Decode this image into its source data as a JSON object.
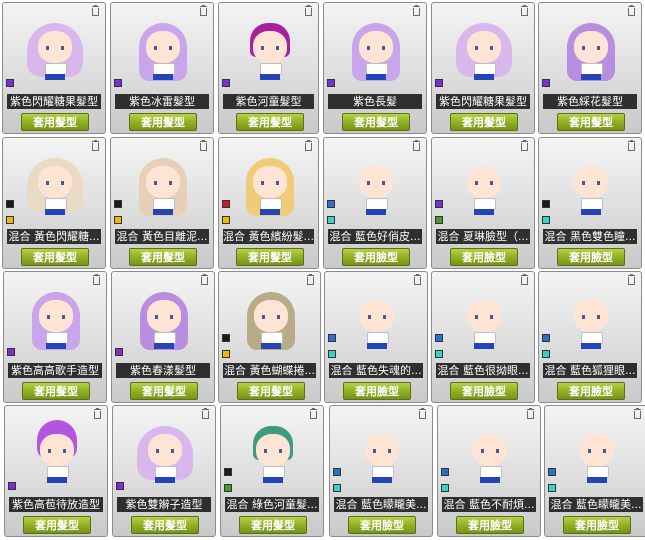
{
  "actions": {
    "apply_hair": "套用髮型",
    "apply_face": "套用臉型"
  },
  "colors": {
    "button_green": "#8fae22",
    "name_bar": "#2f2f2f",
    "purple": "#7a2fd0",
    "black": "#1a1a1a",
    "yellow": "#f2b800",
    "red": "#d01a1a",
    "green": "#4c9a2a",
    "blue": "#2870d0",
    "teal": "#3ccfc8"
  },
  "cards": [
    {
      "name": "紫色閃耀糖果髮型",
      "action": "套用髮型",
      "swatches": [
        "purple"
      ],
      "look": "lavender-twintails"
    },
    {
      "name": "紫色冰雷髮型",
      "action": "套用髮型",
      "swatches": [
        "purple"
      ],
      "look": "lavender-long"
    },
    {
      "name": "紫色河童髮型",
      "action": "套用髮型",
      "swatches": [
        "purple"
      ],
      "look": "magenta-bob"
    },
    {
      "name": "紫色長髮",
      "action": "套用髮型",
      "swatches": [
        "purple"
      ],
      "look": "lavender-long"
    },
    {
      "name": "紫色閃耀糖果髮型",
      "action": "套用髮型",
      "swatches": [
        "purple"
      ],
      "look": "lavender-twintails"
    },
    {
      "name": "紫色綵花髮型",
      "action": "套用髮型",
      "swatches": [
        "purple"
      ],
      "look": "lavender-wavy"
    },
    {
      "name": "混合 黃色閃耀糖...",
      "action": "套用髮型",
      "swatches": [
        "black",
        "yellow"
      ],
      "look": "cream-twintails"
    },
    {
      "name": "混合 黃色目離泥...",
      "action": "套用髮型",
      "swatches": [
        "black",
        "yellow"
      ],
      "look": "cream-long"
    },
    {
      "name": "混合 黃色繽紛髮...",
      "action": "套用髮型",
      "swatches": [
        "red",
        "yellow"
      ],
      "look": "blonde-wavy"
    },
    {
      "name": "混合 藍色好俏皮...",
      "action": "套用臉型",
      "swatches": [
        "blue",
        "teal"
      ],
      "look": "bald"
    },
    {
      "name": "混合 夏琳臉型（...",
      "action": "套用臉型",
      "swatches": [
        "purple",
        "green"
      ],
      "look": "bald"
    },
    {
      "name": "混合 黑色雙色瞳...",
      "action": "套用臉型",
      "swatches": [
        "black",
        "teal"
      ],
      "look": "bald"
    },
    {
      "name": "紫色高高歌手造型",
      "action": "套用髮型",
      "swatches": [
        "purple"
      ],
      "look": "lavender-long"
    },
    {
      "name": "紫色春漾髮型",
      "action": "套用髮型",
      "swatches": [
        "purple"
      ],
      "look": "lavender-wavy"
    },
    {
      "name": "混合 黃色蝴蝶捲...",
      "action": "套用髮型",
      "swatches": [
        "black",
        "yellow"
      ],
      "look": "khaki-ponytail"
    },
    {
      "name": "混合 藍色失魂的...",
      "action": "套用臉型",
      "swatches": [
        "blue",
        "teal"
      ],
      "look": "bald"
    },
    {
      "name": "混合 藍色很拗眼...",
      "action": "套用臉型",
      "swatches": [
        "blue",
        "teal"
      ],
      "look": "bald"
    },
    {
      "name": "混合 藍色狐狸眼...",
      "action": "套用臉型",
      "swatches": [
        "blue",
        "teal"
      ],
      "look": "bald"
    },
    {
      "name": "紫色高苞待放造型",
      "action": "套用髮型",
      "swatches": [
        "purple"
      ],
      "look": "magenta-bun"
    },
    {
      "name": "紫色雙辮子造型",
      "action": "套用髮型",
      "swatches": [
        "purple"
      ],
      "look": "lavender-twintails"
    },
    {
      "name": "混合 綠色河童髮...",
      "action": "套用髮型",
      "swatches": [
        "black",
        "green"
      ],
      "look": "green-bob"
    },
    {
      "name": "混合 藍色矇矓美...",
      "action": "套用臉型",
      "swatches": [
        "blue",
        "teal"
      ],
      "look": "bald"
    },
    {
      "name": "混合 藍色不耐煩...",
      "action": "套用臉型",
      "swatches": [
        "blue",
        "teal"
      ],
      "look": "bald"
    },
    {
      "name": "混合 藍色矇矓美...",
      "action": "套用臉型",
      "swatches": [
        "blue",
        "teal"
      ],
      "look": "bald"
    }
  ]
}
